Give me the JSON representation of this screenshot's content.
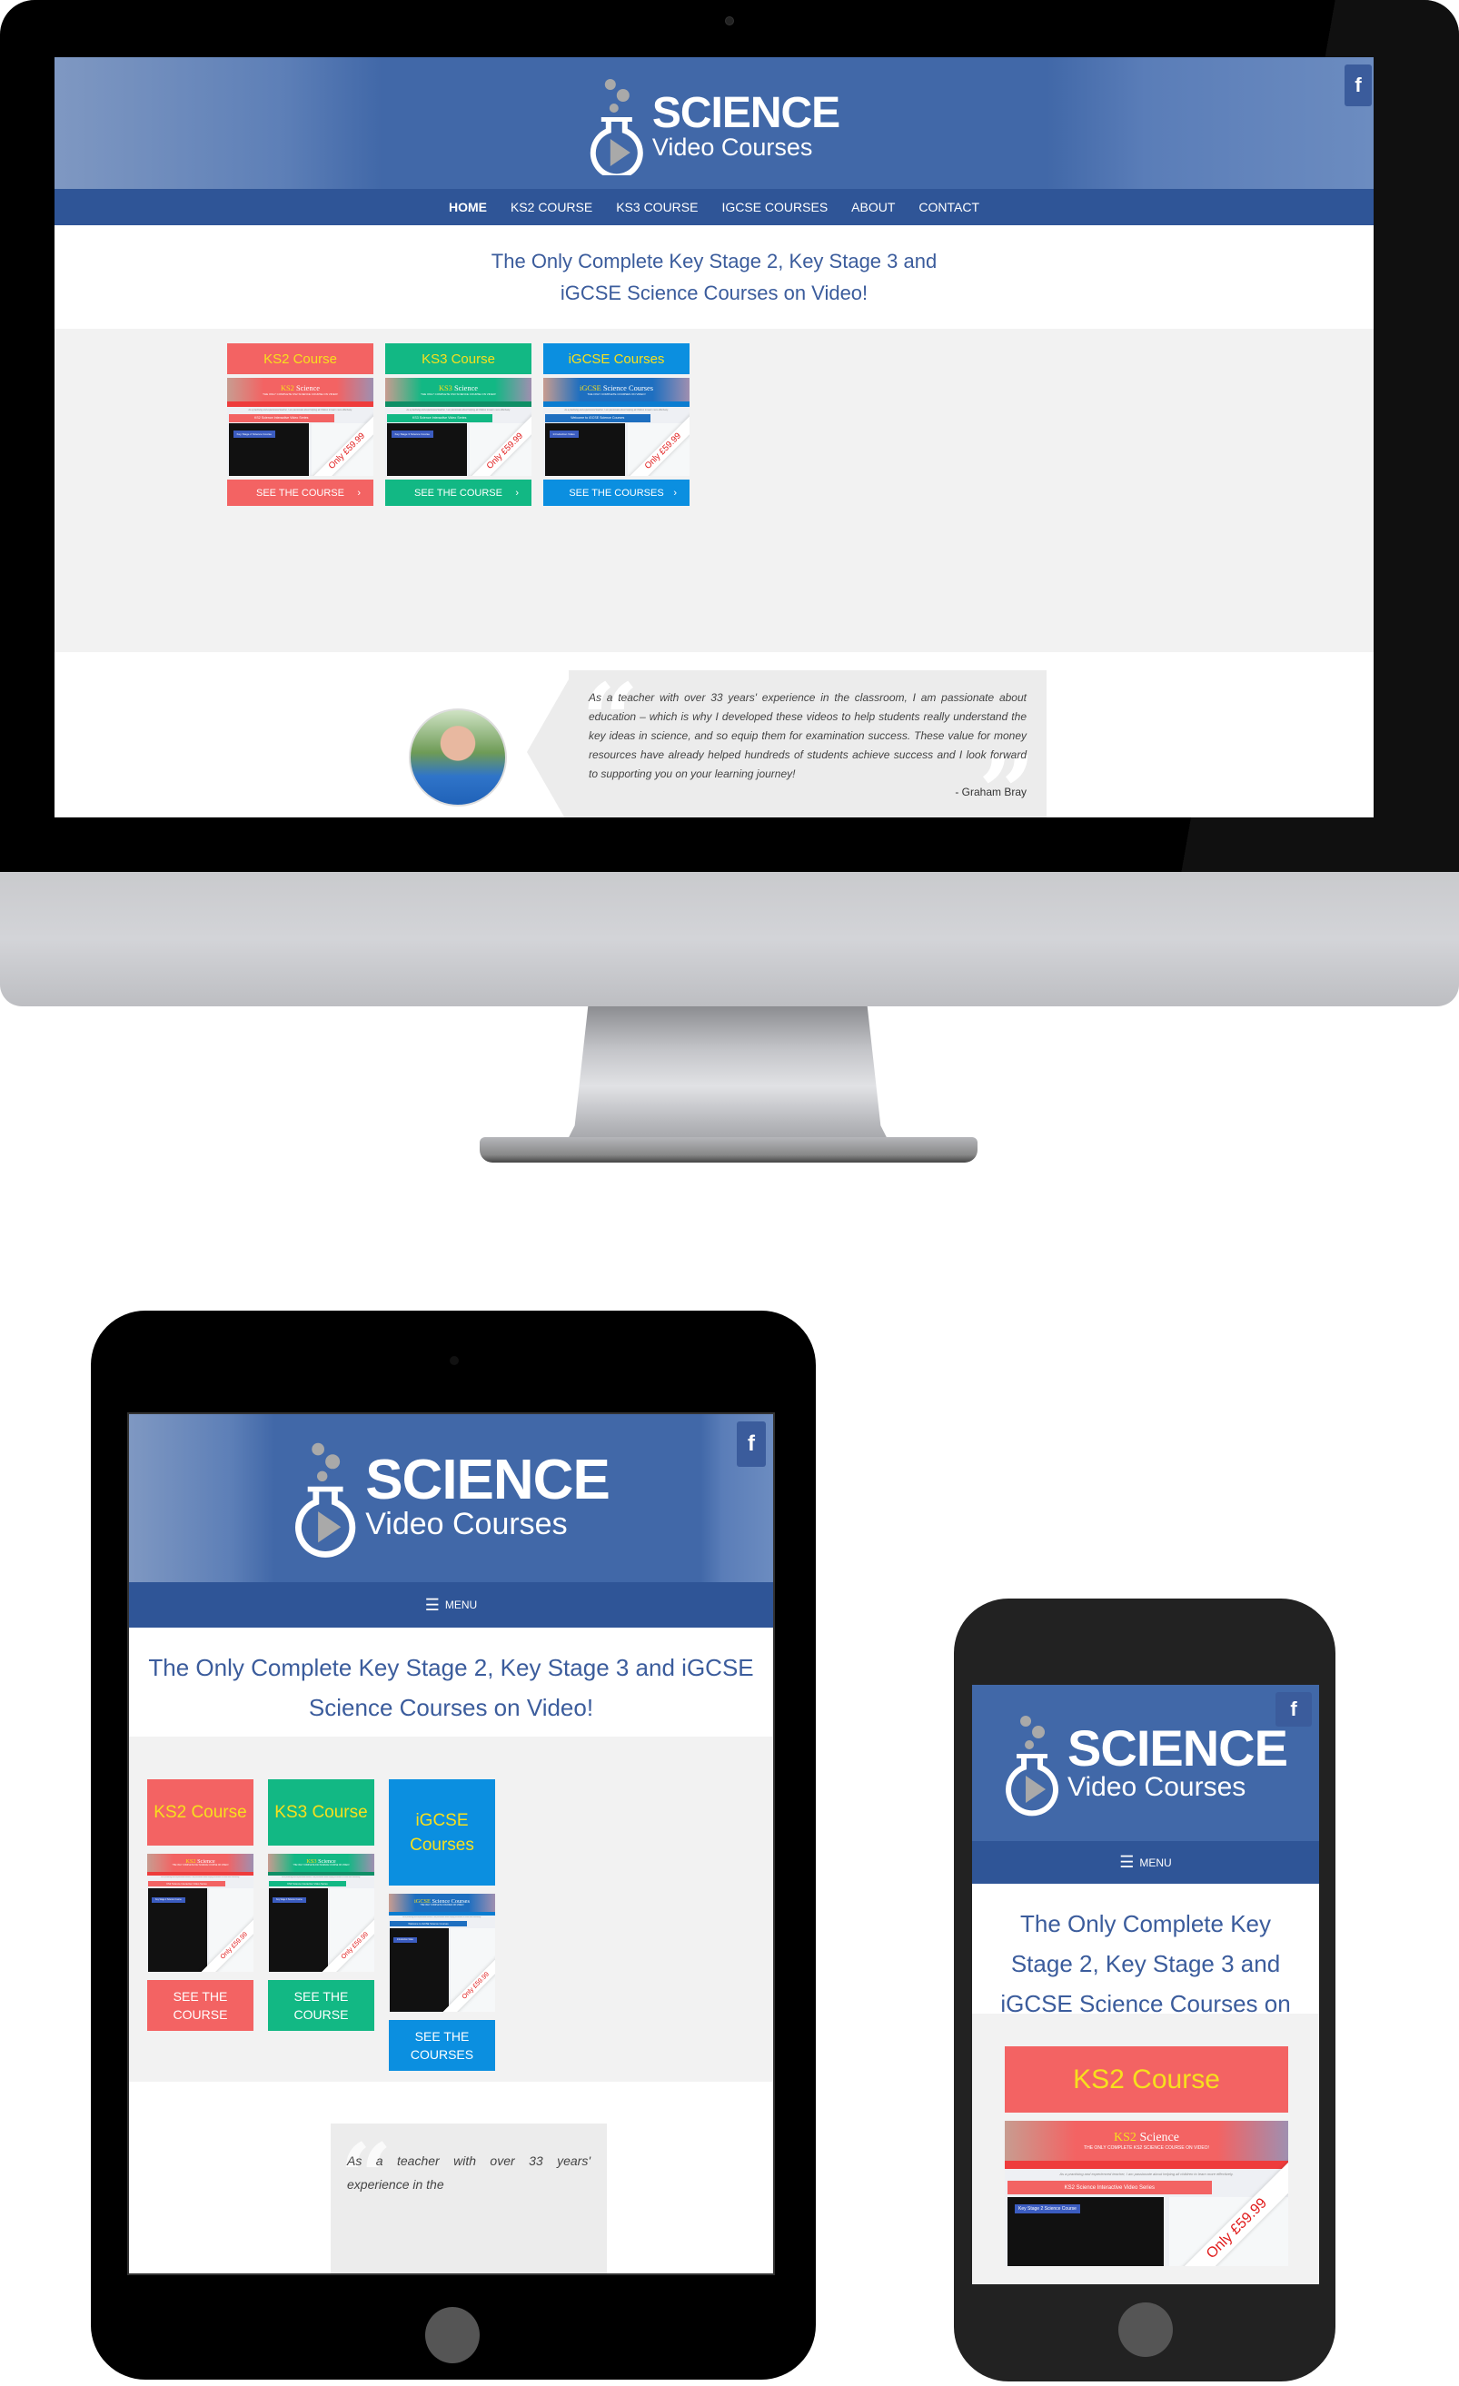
{
  "site": {
    "logo_line1": "SCIENCE",
    "logo_line2": "Video Courses",
    "facebook_icon": "f",
    "menu_label": "MENU",
    "tagline": "The Only Complete Key Stage 2, Key Stage 3 and iGCSE Science Courses on Video!",
    "tagline_line1": "The Only Complete Key Stage 2, Key Stage 3 and",
    "tagline_line2": "iGCSE Science Courses on Video!",
    "nav": [
      "HOME",
      "KS2 COURSE",
      "KS3 COURSE",
      "IGCSE COURSES",
      "ABOUT",
      "CONTACT"
    ],
    "nav_active": "HOME",
    "colors": {
      "header_blue": "#4168a8",
      "nav_blue": "#2f5597",
      "ks2_red": "#f36363",
      "ks3_green": "#12b884",
      "igcse_blue": "#0b8fe0",
      "title_yellow": "#f7e01d",
      "price_red": "#e01b1b"
    }
  },
  "cards": [
    {
      "title": "KS2 Course",
      "button": "SEE THE COURSE",
      "button_arrow": "›",
      "price": "Only £59.99",
      "thumb_brand": "KS2",
      "thumb_brand_suffix": "Science",
      "thumb_strap": "THE ONLY COMPLETE KS2 SCIENCE COURSE ON VIDEO!",
      "thumb_quote": "As a practising and experienced teacher, I am passionate about helping all children to learn more effectively.",
      "thumb_band": "KS2 Science Interactive Video Series",
      "thumb_video_label": "Key Stage 2 Science Course"
    },
    {
      "title": "KS3 Course",
      "button": "SEE THE COURSE",
      "button_arrow": "›",
      "price": "Only £59.99",
      "thumb_brand": "KS3",
      "thumb_brand_suffix": "Science",
      "thumb_strap": "THE ONLY COMPLETE KS3 SCIENCE COURSE ON VIDEO!",
      "thumb_quote": "As a practising and experienced teacher, I am passionate about helping all children to learn more effectively.",
      "thumb_band": "KS3 Science Interactive Video Series",
      "thumb_video_label": "Key Stage 3 Science Course"
    },
    {
      "title": "iGCSE Courses",
      "title_wrapped": [
        "iGCSE",
        "Courses"
      ],
      "button": "SEE THE COURSES",
      "button_arrow": "›",
      "price": "Only £59.99",
      "thumb_brand": "iGCSE",
      "thumb_brand_suffix": "Science Courses",
      "thumb_strap": "THE ONLY COMPLETE COURSES ON VIDEO!",
      "thumb_quote": "As a practising and experienced teacher, I am passionate about helping all children to learn more effectively.",
      "thumb_band": "Welcome to iGCSE Science Courses",
      "thumb_video_label": "Introduction Video"
    }
  ],
  "testimonial": {
    "text": "As a teacher with over 33 years' experience in the classroom, I am passionate about education – which is why I developed these videos to help students really understand the key ideas in science, and so equip them for examination success. These value for money resources have already helped hundreds of students achieve success and I look forward to supporting you on your learning journey!",
    "author": "- Graham Bray",
    "tablet_excerpt": "As a teacher with over 33 years' experience in the"
  },
  "split": {
    "see_the": "SEE THE",
    "course": "COURSE",
    "courses": "COURSES"
  }
}
